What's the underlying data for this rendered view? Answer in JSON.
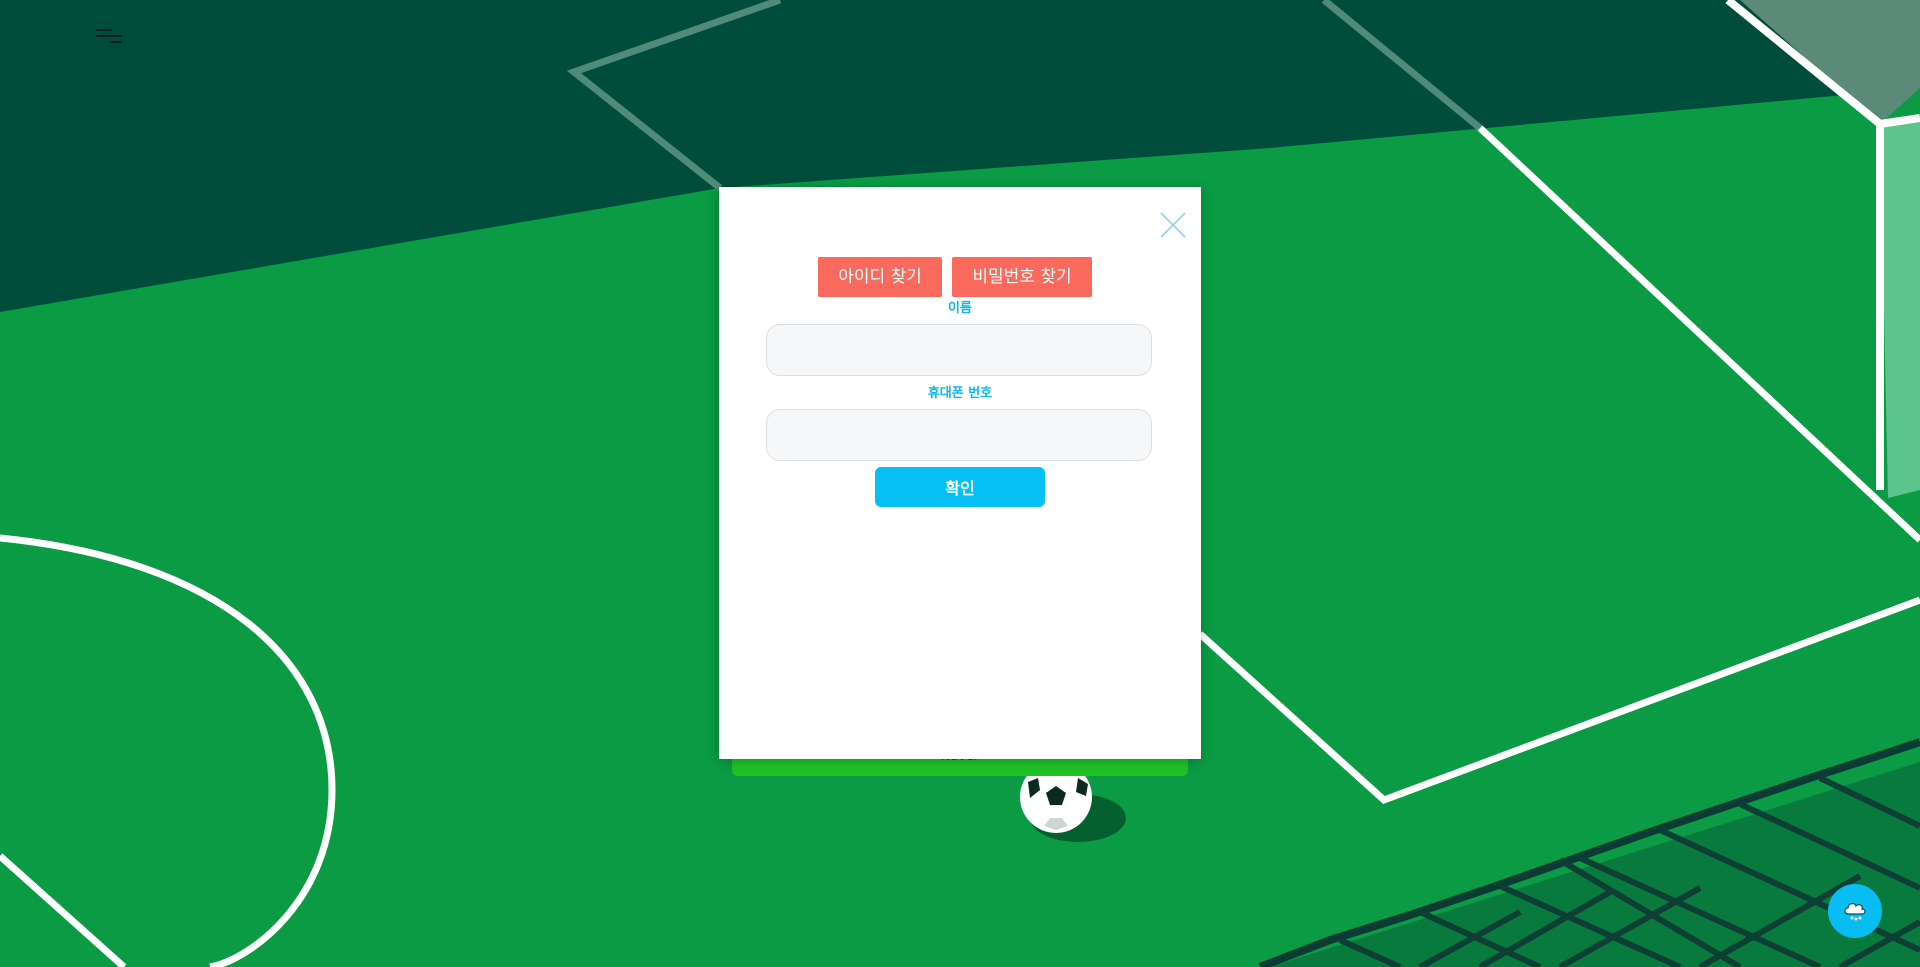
{
  "modal": {
    "tabs": {
      "find_id": "아이디 찾기",
      "find_password": "비밀번호 찾기"
    },
    "fields": {
      "name_label": "이름",
      "name_value": "",
      "phone_label": "휴대폰 번호",
      "phone_value": ""
    },
    "confirm_label": "확인"
  },
  "background": {
    "login_strip_text": "Naver"
  },
  "icons": {
    "menu": "menu-icon",
    "close": "close-icon",
    "chat": "chat-icon"
  },
  "colors": {
    "accent_tab": "#fa6a5c",
    "accent_primary": "#05c0f5",
    "label": "#0fb8e6",
    "field_bg": "#f6f7f9"
  }
}
